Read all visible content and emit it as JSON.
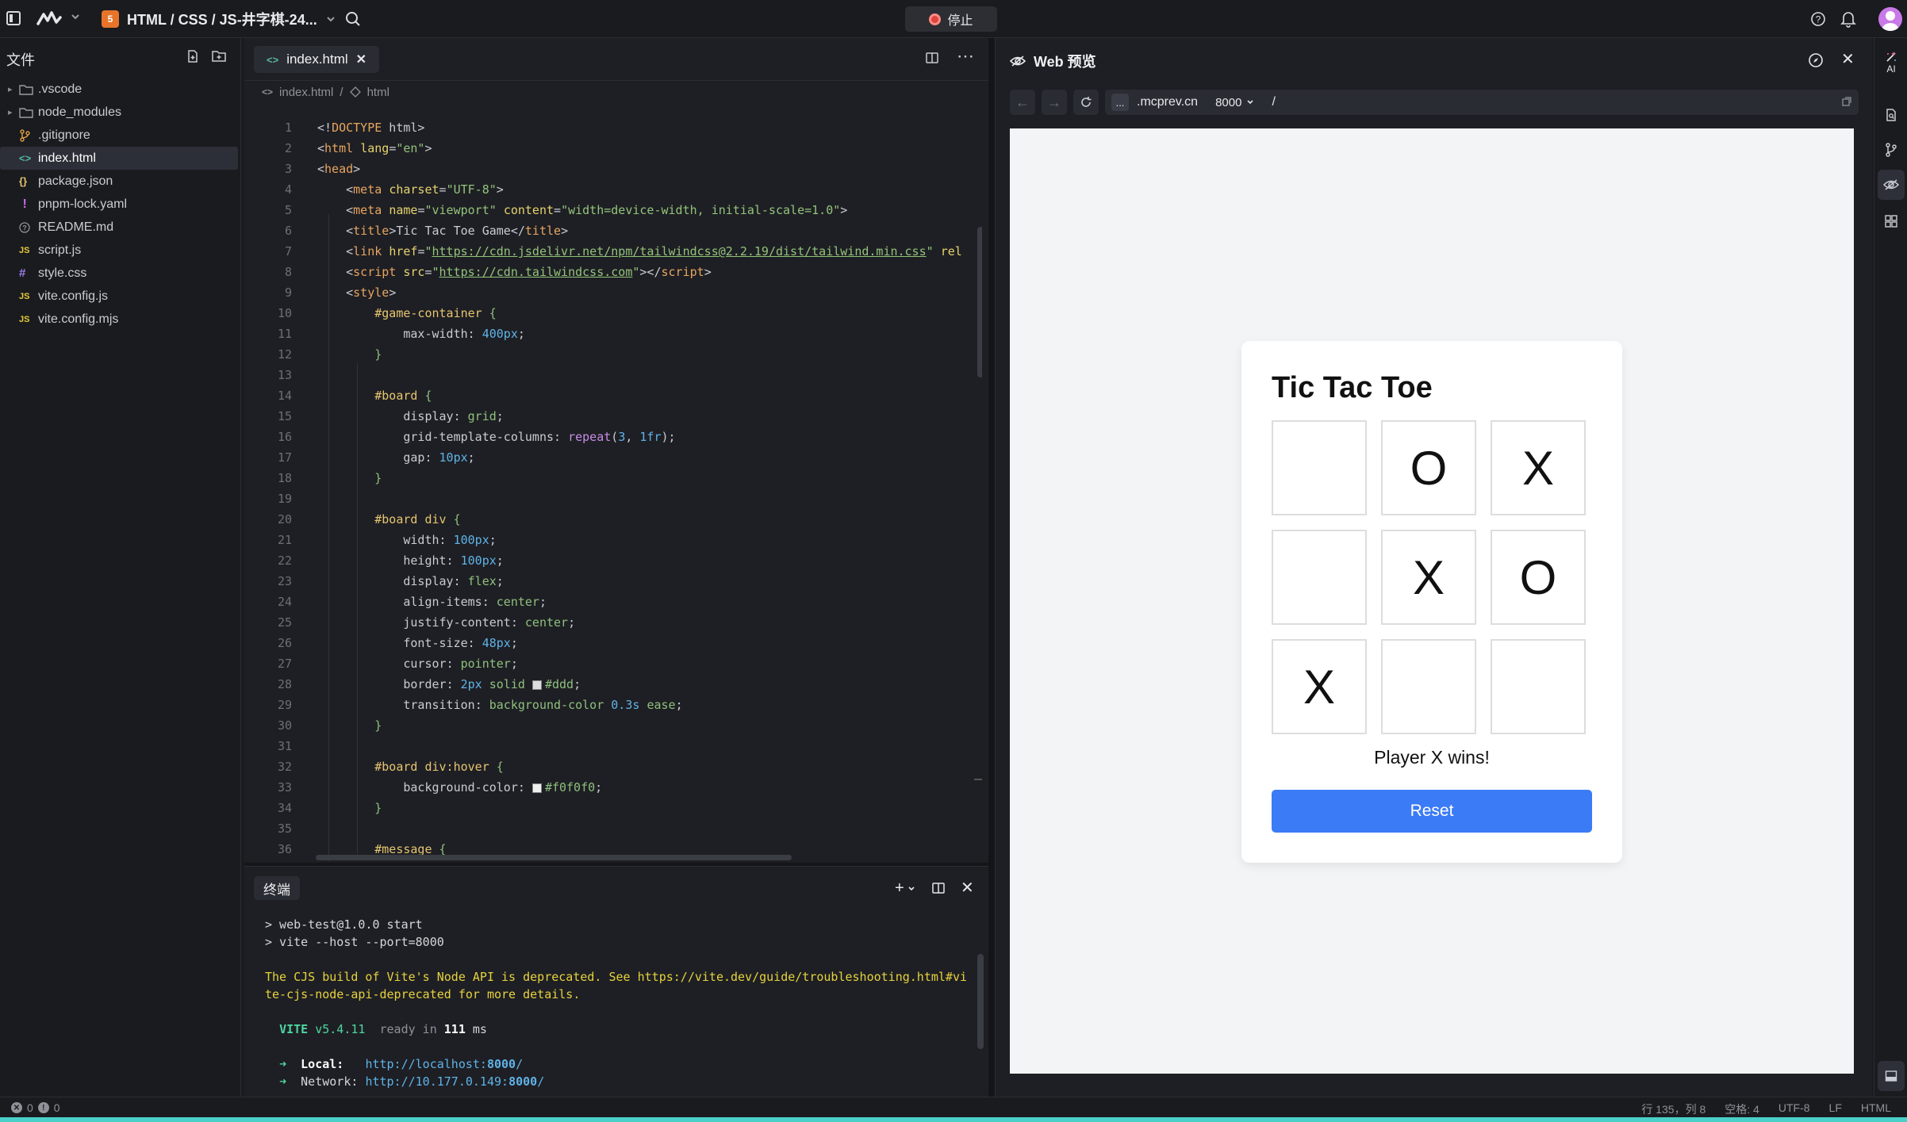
{
  "topbar": {
    "project_title": "HTML / CSS / JS-井字棋-24...",
    "project_badge": "5",
    "stop_label": "停止"
  },
  "explorer": {
    "title": "文件",
    "items": [
      {
        "name": ".vscode",
        "kind": "folder"
      },
      {
        "name": "node_modules",
        "kind": "folder"
      },
      {
        "name": ".gitignore",
        "kind": "git"
      },
      {
        "name": "index.html",
        "kind": "html",
        "selected": true
      },
      {
        "name": "package.json",
        "kind": "json"
      },
      {
        "name": "pnpm-lock.yaml",
        "kind": "yaml"
      },
      {
        "name": "README.md",
        "kind": "info"
      },
      {
        "name": "script.js",
        "kind": "js"
      },
      {
        "name": "style.css",
        "kind": "css"
      },
      {
        "name": "vite.config.js",
        "kind": "js"
      },
      {
        "name": "vite.config.mjs",
        "kind": "js"
      }
    ]
  },
  "editor": {
    "tab_label": "index.html",
    "breadcrumb": [
      "index.html",
      "html"
    ],
    "line_numbers": [
      "1",
      "2",
      "3",
      "4",
      "5",
      "6",
      "7",
      "8",
      "9",
      "10",
      "11",
      "12",
      "13",
      "14",
      "15",
      "16",
      "17",
      "18",
      "19",
      "20",
      "21",
      "22",
      "23",
      "24",
      "25",
      "26",
      "27",
      "28",
      "29",
      "30",
      "31",
      "32",
      "33",
      "34",
      "35",
      "36"
    ],
    "swatch_colors": {
      "ddd": "#dddddd",
      "f0f0f0": "#f0f0f0"
    }
  },
  "terminal": {
    "tab_label": "终端",
    "lines": {
      "l1": "> web-test@1.0.0 start",
      "l2": "> vite --host --port=8000",
      "warn1": "The CJS build of Vite's Node API is deprecated. See https://vite.dev/guide/troubleshooting.html#vi",
      "warn2": "te-cjs-node-api-deprecated for more details.",
      "vite_name": "VITE",
      "vite_version": "v5.4.11",
      "ready": "ready in",
      "ready_ms": "111",
      "ms": "ms",
      "local_label": "Local:",
      "local_url_a": "http://localhost:",
      "local_url_port": "8000",
      "local_url_b": "/",
      "network_label": "Network:",
      "network_url_a": "http://10.177.0.149:",
      "network_url_port": "8000",
      "network_url_b": "/"
    }
  },
  "preview": {
    "title": "Web 预览",
    "url_host": ".mcprev.cn",
    "url_dots": "...",
    "url_port": "8000",
    "url_path": "/",
    "game": {
      "title": "Tic Tac Toe",
      "cells": [
        "",
        "O",
        "X",
        "",
        "X",
        "O",
        "X",
        "",
        ""
      ],
      "message": "Player X wins!",
      "reset_label": "Reset",
      "accent": "#3b7bf6"
    }
  },
  "statusbar": {
    "errors": "0",
    "warnings": "0",
    "position": "行 135，列 8",
    "spaces": "空格: 4",
    "encoding": "UTF-8",
    "eol": "LF",
    "language": "HTML"
  },
  "activity": {
    "ai_label": "AI"
  }
}
